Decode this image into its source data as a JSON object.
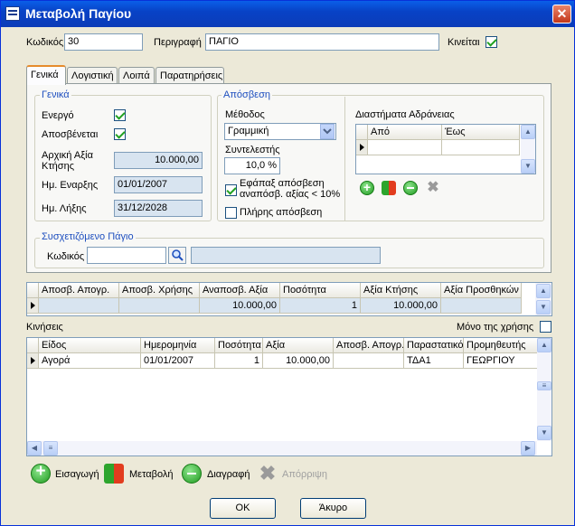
{
  "window": {
    "title": "Μεταβολή Παγίου",
    "close": "✕"
  },
  "header": {
    "code_label": "Κωδικός",
    "code_value": "30",
    "desc_label": "Περιγραφή",
    "desc_value": "ΠΑΓΙΟ",
    "movable_label": "Κινείται",
    "movable_checked": true
  },
  "tabs": [
    "Γενικά",
    "Λογιστική",
    "Λοιπά",
    "Παρατηρήσεις"
  ],
  "general": {
    "title": "Γενικά",
    "active_label": "Ενεργό",
    "depreciable_label": "Αποσβένεται",
    "acq_value_label_1": "Αρχική Αξία",
    "acq_value_label_2": "Κτήσης",
    "acq_value": "10.000,00",
    "start_date_label": "Ημ. Εναρξης",
    "start_date": "01/01/2007",
    "end_date_label": "Ημ. Λήξης",
    "end_date": "31/12/2028"
  },
  "depreciation": {
    "title": "Απόσβεση",
    "method_label": "Μέθοδος",
    "method_value": "Γραμμική",
    "coef_label": "Συντελεστής",
    "coef_value": "10,0 %",
    "once_label_1": "Εφάπαξ απόσβεση",
    "once_label_2": "αναπόσβ. αξίας < 10%",
    "full_label": "Πλήρης απόσβεση"
  },
  "idle": {
    "title": "Διαστήματα Αδράνειας",
    "col_from": "Από",
    "col_to": "Έως"
  },
  "related": {
    "title": "Συσχετιζόμενο Πάγιο",
    "code_label": "Κωδικός"
  },
  "summary_grid": {
    "headers": [
      "Αποσβ. Απογρ.",
      "Αποσβ. Χρήσης",
      "Αναποσβ. Αξία",
      "Ποσότητα",
      "Αξία Κτήσης",
      "Αξία Προσθηκών"
    ],
    "row": [
      "",
      "",
      "10.000,00",
      "1",
      "10.000,00",
      ""
    ]
  },
  "movements": {
    "title": "Κινήσεις",
    "only_year_label": "Μόνο της χρήσης",
    "headers": [
      "Είδος",
      "Ημερομηνία",
      "Ποσότητα",
      "Αξία",
      "Αποσβ. Απογρ.",
      "Παραστατικό",
      "Προμηθευτής"
    ],
    "rows": [
      [
        "Αγορά",
        "01/01/2007",
        "1",
        "10.000,00",
        "",
        "ΤΔΑ1",
        "ΓΕΩΡΓΙΟΥ"
      ]
    ]
  },
  "actions": {
    "insert": "Εισαγωγή",
    "edit": "Μεταβολή",
    "delete": "Διαγραφή",
    "reject": "Απόρριψη"
  },
  "footer": {
    "ok": "OK",
    "cancel": "Άκυρο"
  }
}
